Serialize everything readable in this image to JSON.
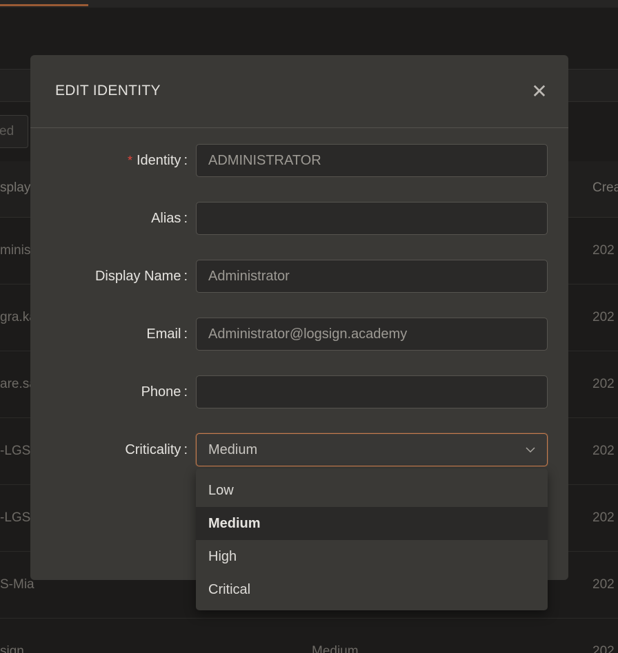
{
  "background": {
    "filter_placeholder": "ed",
    "columns": {
      "display": "splay",
      "created": "Crea"
    },
    "rows": [
      {
        "display": "minis",
        "created": "202"
      },
      {
        "display": "gra.ka",
        "created": "202"
      },
      {
        "display": "are.sa",
        "created": "202"
      },
      {
        "display": "-LGSC",
        "created": "202"
      },
      {
        "display": "-LGSC",
        "created": "202"
      },
      {
        "display": "S-Mia",
        "created": "202"
      },
      {
        "display": "sign",
        "criticality": "Medium",
        "created": "202"
      }
    ]
  },
  "modal": {
    "title": "EDIT IDENTITY",
    "close_glyph": "✕",
    "fields": {
      "identity": {
        "label": "Identity",
        "required": "*",
        "value": "ADMINISTRATOR"
      },
      "alias": {
        "label": "Alias",
        "value": ""
      },
      "display_name": {
        "label": "Display Name",
        "value": "Administrator"
      },
      "email": {
        "label": "Email",
        "value": "Administrator@logsign.academy"
      },
      "phone": {
        "label": "Phone",
        "value": ""
      },
      "criticality": {
        "label": "Criticality",
        "value": "Medium"
      }
    },
    "colon": ":"
  },
  "dropdown": {
    "options": [
      {
        "label": "Low"
      },
      {
        "label": "Medium"
      },
      {
        "label": "High"
      },
      {
        "label": "Critical"
      }
    ],
    "selected_index": 1
  },
  "colors": {
    "accent": "#c57c4e",
    "required": "#e0453c",
    "modal_bg": "#3a3936",
    "input_bg": "#2a2928"
  }
}
